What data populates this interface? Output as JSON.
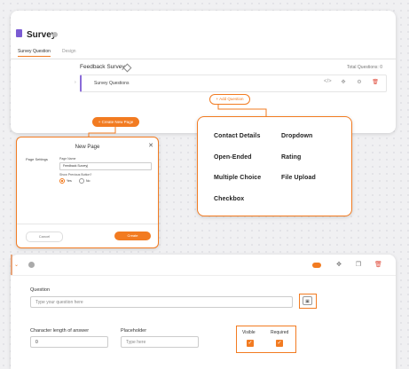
{
  "survey": {
    "title": "Survey",
    "tabs": [
      {
        "label": "Survey Question"
      },
      {
        "label": "Design"
      }
    ],
    "name": "Feedback Survey",
    "total_questions": "Total Questions: 0",
    "section_label": "Survey Questions",
    "add_question_label": "+ Add Question",
    "create_new_page_label": "+ Create New Page"
  },
  "new_page_modal": {
    "title": "New Page",
    "page_settings_label": "Page Settings",
    "page_name_label": "Page Name",
    "page_name_value": "Feedback Survey|",
    "show_previous_label": "Show Previous Button?",
    "yes_label": "Yes",
    "no_label": "No",
    "cancel_label": "Cancel",
    "create_label": "Create"
  },
  "question_types": [
    "Contact Details",
    "Dropdown",
    "Open-Ended",
    "Rating",
    "Multiple Choice",
    "File Upload",
    "Checkbox"
  ],
  "question_editor": {
    "question_label": "Question",
    "question_placeholder": "Type your question here",
    "char_length_label": "Character length of answer",
    "char_length_value": "0",
    "placeholder_label": "Placeholder",
    "placeholder_placeholder": "Type here",
    "visible_label": "Visible",
    "required_label": "Required",
    "visible_checked": true,
    "required_checked": true
  },
  "colors": {
    "accent": "#f27b21",
    "section_bar": "#8a6bd8",
    "delete": "#e04d3d"
  },
  "icons": {
    "survey": "document-icon",
    "info": "info-icon",
    "edit": "pencil-icon",
    "code": "code-icon",
    "move": "move-icon",
    "settings": "gear-icon",
    "delete": "trash-icon",
    "copy": "copy-icon",
    "image": "image-icon",
    "close": "close-icon",
    "expand": "chevron-down-icon",
    "toggle": "toggle-switch"
  }
}
